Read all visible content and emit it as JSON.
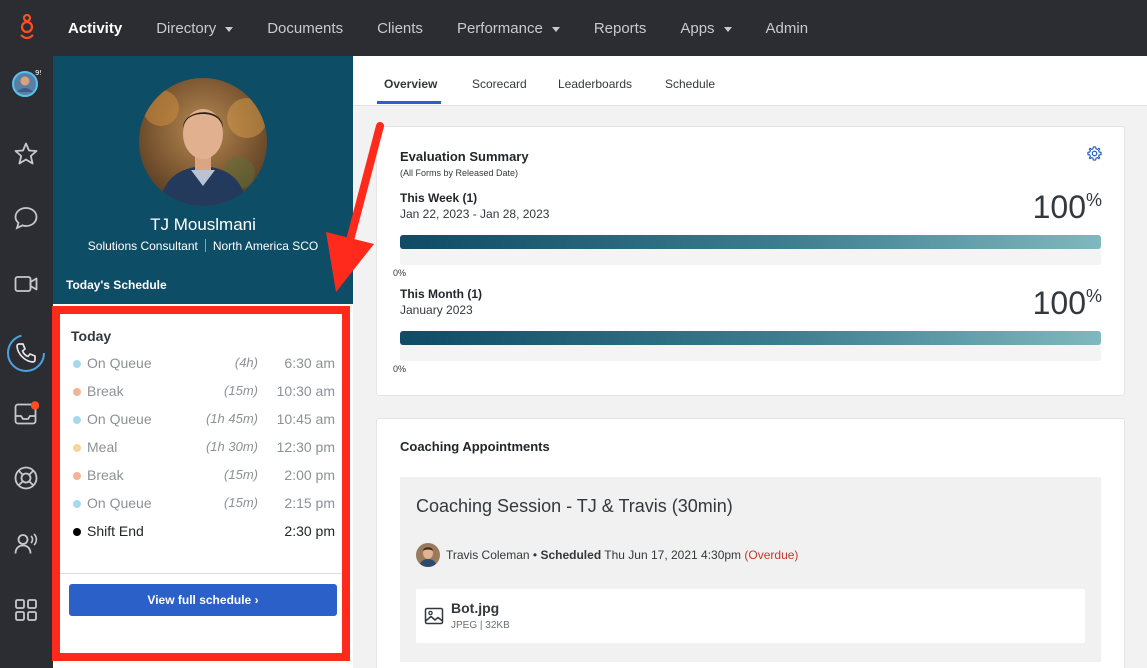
{
  "topnav": {
    "items": [
      {
        "label": "Activity",
        "active": true,
        "has_dropdown": false
      },
      {
        "label": "Directory",
        "active": false,
        "has_dropdown": true
      },
      {
        "label": "Documents",
        "active": false,
        "has_dropdown": false
      },
      {
        "label": "Clients",
        "active": false,
        "has_dropdown": false
      },
      {
        "label": "Performance",
        "active": false,
        "has_dropdown": true
      },
      {
        "label": "Reports",
        "active": false,
        "has_dropdown": false
      },
      {
        "label": "Apps",
        "active": false,
        "has_dropdown": true
      },
      {
        "label": "Admin",
        "active": false,
        "has_dropdown": false
      }
    ]
  },
  "rail": {
    "icons": [
      "avatar-status-icon",
      "star-icon",
      "chat-icon",
      "video-icon",
      "phone-icon",
      "inbox-icon",
      "lifebuoy-icon",
      "voice-user-icon",
      "apps-grid-icon"
    ]
  },
  "profile": {
    "name": "TJ Mouslmani",
    "title": "Solutions Consultant",
    "location": "North America SCO",
    "schedule_heading": "Today's Schedule"
  },
  "schedule": {
    "day_label": "Today",
    "items": [
      {
        "activity": "On Queue",
        "duration": "(4h)",
        "time": "6:30 am",
        "color": "#a8d8ec"
      },
      {
        "activity": "Break",
        "duration": "(15m)",
        "time": "10:30 am",
        "color": "#f2b497"
      },
      {
        "activity": "On Queue",
        "duration": "(1h 45m)",
        "time": "10:45 am",
        "color": "#a8d8ec"
      },
      {
        "activity": "Meal",
        "duration": "(1h 30m)",
        "time": "12:30 pm",
        "color": "#f7d59a"
      },
      {
        "activity": "Break",
        "duration": "(15m)",
        "time": "2:00 pm",
        "color": "#f2b497"
      },
      {
        "activity": "On Queue",
        "duration": "(15m)",
        "time": "2:15 pm",
        "color": "#a8d8ec"
      },
      {
        "activity": "Shift End",
        "duration": "",
        "time": "2:30 pm",
        "color": "#000000"
      }
    ],
    "view_button": "View full schedule ›"
  },
  "tabs": [
    "Overview",
    "Scorecard",
    "Leaderboards",
    "Schedule"
  ],
  "evaluation": {
    "title": "Evaluation Summary",
    "subtitle": "(All Forms by Released Date)",
    "periods": [
      {
        "label": "This Week (1)",
        "range": "Jan 22, 2023 - Jan 28, 2023",
        "value": "100",
        "unit": "%",
        "fill": 1.0,
        "min_label": "0%"
      },
      {
        "label": "This Month (1)",
        "range": "January 2023",
        "value": "100",
        "unit": "%",
        "fill": 1.0,
        "min_label": "0%"
      }
    ]
  },
  "coaching": {
    "title": "Coaching Appointments",
    "session_title": "Coaching Session - TJ & Travis (30min)",
    "person": "Travis Coleman",
    "bullet": "•",
    "status": "Scheduled",
    "datetime": "Thu Jun 17, 2021 4:30pm",
    "overdue": "(Overdue)",
    "attachment": {
      "name": "Bot.jpg",
      "meta": "JPEG | 32KB"
    }
  },
  "colors": {
    "topbar": "#2c2d32",
    "profile_bg": "#0d4e66",
    "primary": "#2a60c8",
    "highlight": "#ff2a1c",
    "overdue": "#c0392b"
  }
}
